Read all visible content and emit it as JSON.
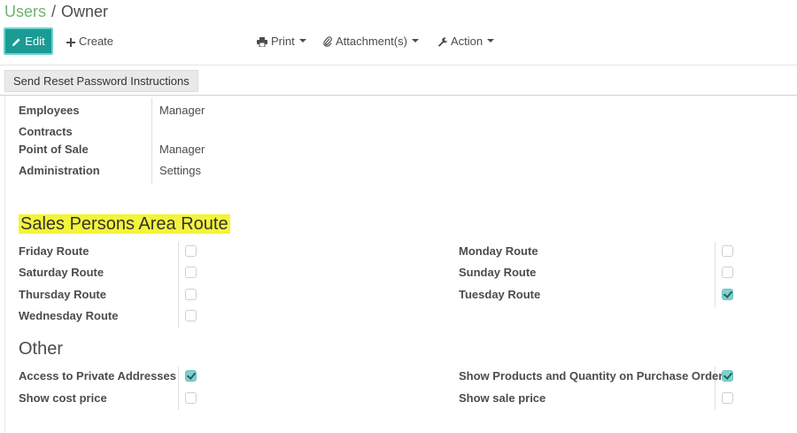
{
  "breadcrumb": {
    "parent": "Users",
    "separator": "/",
    "current": "Owner"
  },
  "toolbar": {
    "edit_label": "Edit",
    "create_label": "Create",
    "print_label": "Print",
    "attachment_label": "Attachment(s)",
    "action_label": "Action"
  },
  "statusbar": {
    "reset_button": "Send Reset Password Instructions"
  },
  "access_rights": [
    {
      "label": "Employees",
      "value": "Manager"
    },
    {
      "label": "Contracts",
      "value": ""
    },
    {
      "label": "Point of Sale",
      "value": "Manager"
    },
    {
      "label": "Administration",
      "value": "Settings"
    }
  ],
  "routes": {
    "title": "Sales Persons Area Route",
    "left": [
      {
        "label": "Friday Route",
        "checked": false
      },
      {
        "label": "Saturday Route",
        "checked": false
      },
      {
        "label": "Thursday Route",
        "checked": false
      },
      {
        "label": "Wednesday Route",
        "checked": false
      }
    ],
    "right": [
      {
        "label": "Monday Route",
        "checked": false
      },
      {
        "label": "Sunday Route",
        "checked": false
      },
      {
        "label": "Tuesday Route",
        "checked": true
      }
    ]
  },
  "other": {
    "title": "Other",
    "left": [
      {
        "label": "Access to Private Addresses",
        "checked": true
      },
      {
        "label": "Show cost price",
        "checked": false
      }
    ],
    "right": [
      {
        "label": "Show Products and Quantity on Purchase Order",
        "checked": true
      },
      {
        "label": "Show sale price",
        "checked": false
      }
    ]
  },
  "colors": {
    "primary": "#1a9b94",
    "breadcrumb_link": "#6cb56c",
    "highlight": "#f4f43a",
    "checked": "#7fd1cc"
  }
}
